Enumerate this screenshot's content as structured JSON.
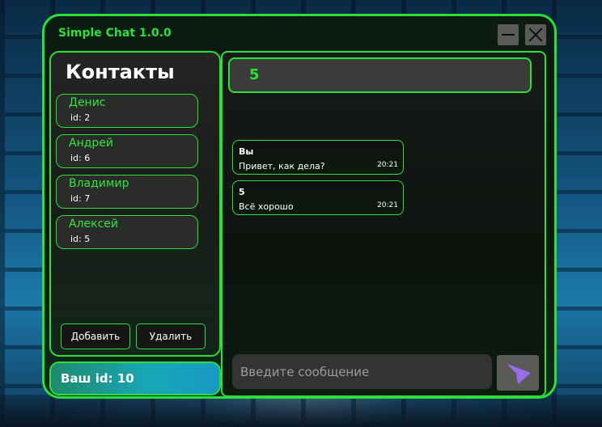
{
  "window": {
    "title": "Simple Chat 1.0.0"
  },
  "contacts": {
    "title": "Контакты",
    "items": [
      {
        "name": "Денис",
        "id": "id: 2"
      },
      {
        "name": "Андрей",
        "id": "id: 6"
      },
      {
        "name": "Владимир",
        "id": "id: 7"
      },
      {
        "name": "Алексей",
        "id": "id: 5"
      }
    ],
    "add_label": "Добавить",
    "delete_label": "Удалить"
  },
  "me": {
    "id_label": "Ваш id: 10"
  },
  "chat": {
    "header": "5",
    "messages": [
      {
        "sender": "Вы",
        "text": "Привет, как дела?",
        "time": "20:21"
      },
      {
        "sender": "5",
        "text": "Всё хорошо",
        "time": "20:21"
      }
    ],
    "input_placeholder": "Введите сообщение"
  },
  "colors": {
    "accent": "#2be03a",
    "send_icon": "#9b6cf0"
  },
  "icons": {
    "minimize": "minimize-icon",
    "close": "close-icon",
    "send": "send-icon"
  }
}
